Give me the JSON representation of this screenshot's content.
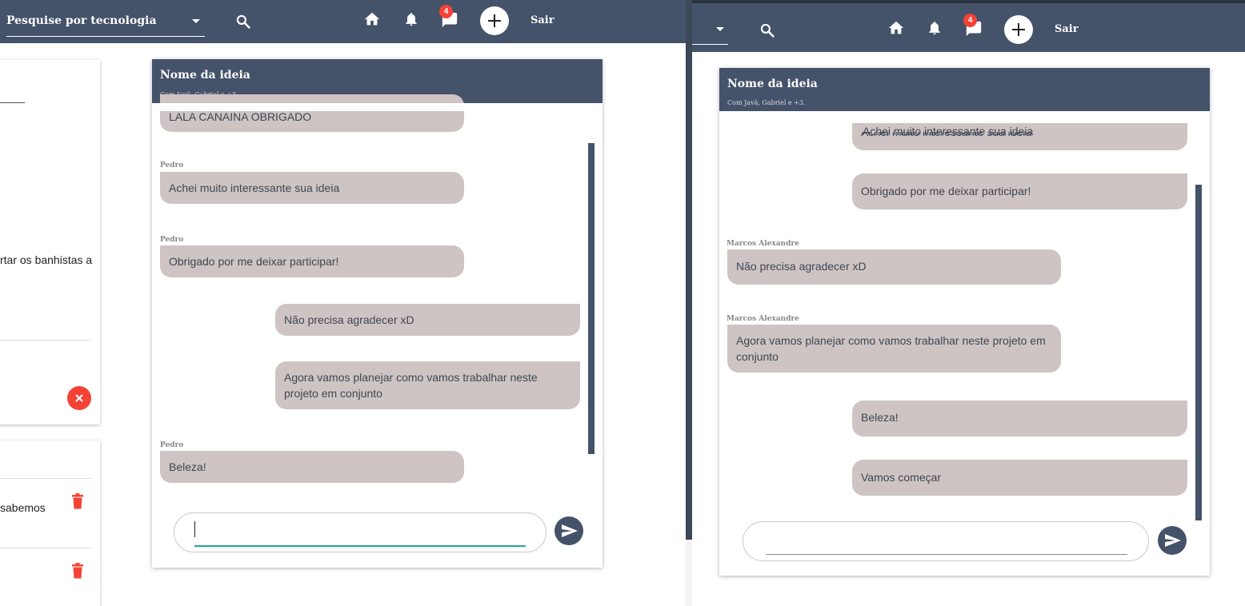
{
  "colors": {
    "navbar": "#44526a",
    "bubble": "#cec4c3",
    "danger": "#f44336",
    "input_focus": "#26a69a"
  },
  "left": {
    "navbar": {
      "search_select": "Pesquise por tecnologia",
      "notification_count": "4",
      "logout": "Sair",
      "icons": [
        "search-icon",
        "home-icon",
        "bell-icon",
        "chat-icon",
        "plus-icon"
      ]
    },
    "background_card": {
      "snippet_1": "rtar os banhistas a",
      "snippet_2": "sabemos"
    },
    "chat": {
      "title": "Nome da ideia",
      "subtitle": "Com Javã, Gabriel e +3.",
      "cut_text": "LALA CANAINA OBRIGADO",
      "messages": [
        {
          "sender": "Pedro",
          "text": "Achei muito interessante sua ideia",
          "mine": false
        },
        {
          "sender": "Pedro",
          "text": "Obrigado por me deixar participar!",
          "mine": false
        },
        {
          "sender": "",
          "text": "Não precisa agradecer xD",
          "mine": true
        },
        {
          "sender": "",
          "text": "Agora vamos planejar como vamos trabalhar neste projeto em conjunto",
          "mine": true
        },
        {
          "sender": "Pedro",
          "text": "Beleza!",
          "mine": false
        }
      ],
      "input_value": ""
    }
  },
  "right": {
    "navbar": {
      "notification_count": "4",
      "logout": "Sair",
      "icons": [
        "search-icon",
        "home-icon",
        "bell-icon",
        "chat-icon",
        "plus-icon"
      ]
    },
    "chat": {
      "title": "Nome da ideia",
      "subtitle": "Com Javã, Gabriel e +3.",
      "messages": [
        {
          "sender": "",
          "text": "Achei muito interessante sua ideia",
          "mine": true
        },
        {
          "sender": "",
          "text": "Obrigado por me deixar participar!",
          "mine": true
        },
        {
          "sender": "Marcos Alexandre",
          "text": "Não precisa agradecer xD",
          "mine": false
        },
        {
          "sender": "Marcos Alexandre",
          "text": "Agora vamos planejar como vamos trabalhar neste projeto em conjunto",
          "mine": false
        },
        {
          "sender": "",
          "text": "Beleza!",
          "mine": true
        },
        {
          "sender": "",
          "text": "Vamos começar",
          "mine": true
        }
      ],
      "input_value": ""
    }
  }
}
